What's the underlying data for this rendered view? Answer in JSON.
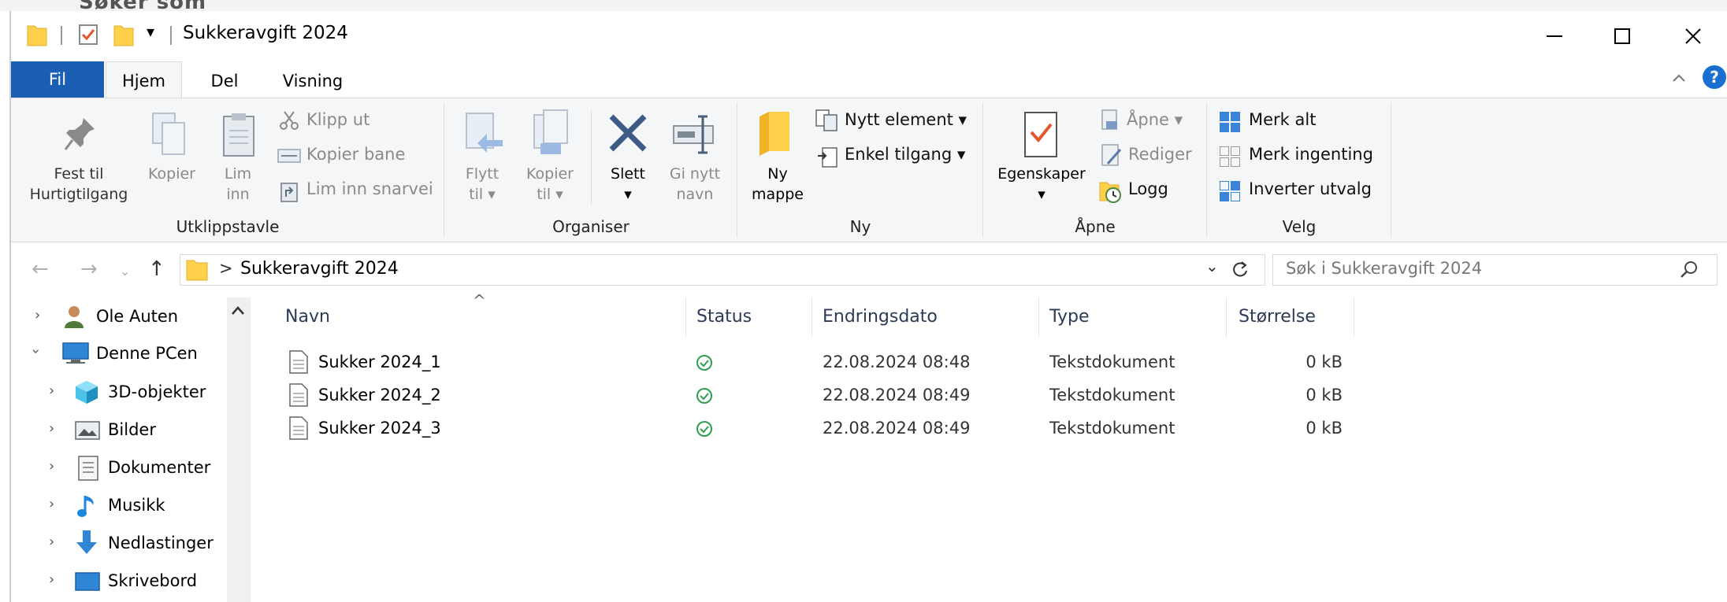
{
  "background_text": "Søker som",
  "window": {
    "title": "Sukkeravgift 2024",
    "qat_dropdown": "▾"
  },
  "ribbon": {
    "tabs": [
      "Fil",
      "Hjem",
      "Del",
      "Visning"
    ],
    "groups": {
      "clipboard": {
        "label": "Utklippstavle",
        "pin_line1": "Fest til",
        "pin_line2": "Hurtigtilgang",
        "copy": "Kopier",
        "paste_line1": "Lim",
        "paste_line2": "inn",
        "cut": "Klipp ut",
        "copy_path": "Kopier bane",
        "paste_shortcut": "Lim inn snarvei"
      },
      "organize": {
        "label": "Organiser",
        "move_line1": "Flytt",
        "move_line2": "til",
        "copyto_line1": "Kopier",
        "copyto_line2": "til",
        "delete": "Slett",
        "rename_line1": "Gi nytt",
        "rename_line2": "navn"
      },
      "new": {
        "label": "Ny",
        "folder_line1": "Ny",
        "folder_line2": "mappe",
        "new_item": "Nytt element",
        "easy_access": "Enkel tilgang"
      },
      "open": {
        "label": "Åpne",
        "properties": "Egenskaper",
        "open": "Åpne",
        "edit": "Rediger",
        "history": "Logg"
      },
      "select": {
        "label": "Velg",
        "select_all": "Merk alt",
        "select_none": "Merk ingenting",
        "invert": "Inverter utvalg"
      }
    }
  },
  "address": {
    "separator": ">",
    "path": "Sukkeravgift 2024",
    "search_placeholder": "Søk i Sukkeravgift 2024"
  },
  "nav": {
    "items": [
      {
        "label": "Ole Auten",
        "icon": "user-icon"
      },
      {
        "label": "Denne PCen",
        "icon": "computer-icon"
      },
      {
        "label": "3D-objekter",
        "icon": "3d-objects-icon"
      },
      {
        "label": "Bilder",
        "icon": "pictures-icon"
      },
      {
        "label": "Dokumenter",
        "icon": "documents-icon"
      },
      {
        "label": "Musikk",
        "icon": "music-icon"
      },
      {
        "label": "Nedlastinger",
        "icon": "downloads-icon"
      },
      {
        "label": "Skrivebord",
        "icon": "desktop-icon"
      }
    ]
  },
  "filelist": {
    "columns": [
      "Navn",
      "Status",
      "Endringsdato",
      "Type",
      "Størrelse"
    ],
    "rows": [
      {
        "name": "Sukker 2024_1",
        "date": "22.08.2024 08:48",
        "type": "Tekstdokument",
        "size": "0 kB"
      },
      {
        "name": "Sukker 2024_2",
        "date": "22.08.2024 08:49",
        "type": "Tekstdokument",
        "size": "0 kB"
      },
      {
        "name": "Sukker 2024_3",
        "date": "22.08.2024 08:49",
        "type": "Tekstdokument",
        "size": "0 kB"
      }
    ]
  },
  "colors": {
    "accent": "#1a5fb4",
    "folder": "#ffd04a",
    "status_ok": "#2e9e4f"
  }
}
